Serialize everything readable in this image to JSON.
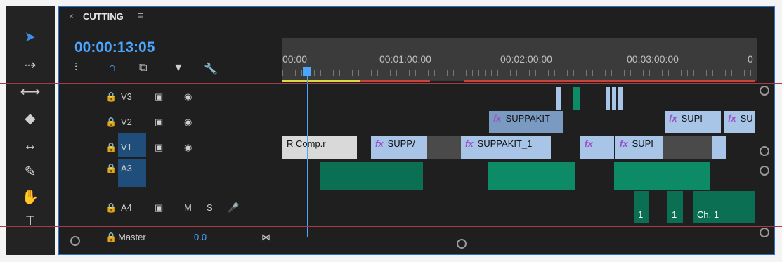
{
  "panel": {
    "close": "×",
    "title": "CUTTING",
    "menu": "≡"
  },
  "timecode": "00:00:13:05",
  "ruler": {
    "labels": [
      "00:00",
      "00:01:00:00",
      "00:02:00:00",
      "00:03:00:00",
      "0"
    ]
  },
  "tracks": {
    "v3": "V3",
    "v2": "V2",
    "v1": "V1",
    "a3": "A3",
    "a4": "A4",
    "master": "Master",
    "m": "M",
    "s": "S",
    "master_value": "0.0"
  },
  "clips": {
    "v2_a": "SUPPAKIT",
    "v2_b": "SUPI",
    "v2_c": "SU",
    "v1_a": "R Comp.r",
    "v1_b": "SUPP/",
    "v1_c": "SUPPAKIT_1",
    "v1_d": "SUPI",
    "fx": "fx",
    "audio_marker_1": "1",
    "audio_marker_2": "1",
    "audio_marker_3": "Ch. 1"
  },
  "colors": {
    "accent": "#3a8ee6",
    "timecode": "#4aa6ff",
    "video_clip": "#a8c5e8",
    "audio_clip": "#0d8a66"
  }
}
